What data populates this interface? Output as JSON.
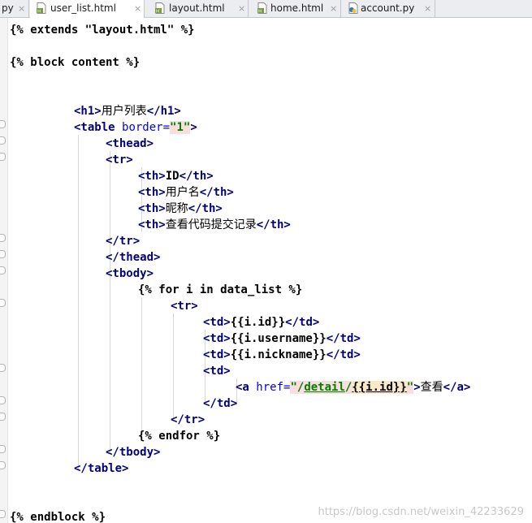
{
  "tabs": [
    {
      "label": "py",
      "active": false
    },
    {
      "label": "user_list.html",
      "active": true
    },
    {
      "label": "layout.html",
      "active": false
    },
    {
      "label": "home.html",
      "active": false
    },
    {
      "label": "account.py",
      "active": false
    }
  ],
  "close_glyph": "×",
  "code": {
    "l1": {
      "a": "{% extends \"layout.html\" %}"
    },
    "l2": {
      "a": "{% block content %}"
    },
    "l3": {
      "t1": "<h1>",
      "txt": "用户列表",
      "t2": "</h1>"
    },
    "l4": {
      "t1": "<table ",
      "attr": "border=",
      "val": "\"1\"",
      "t2": ">"
    },
    "l5": {
      "t": "<thead>"
    },
    "l6": {
      "t": "<tr>"
    },
    "l7": {
      "t1": "<th>",
      "txt": "ID",
      "t2": "</th>"
    },
    "l8": {
      "t1": "<th>",
      "txt": "用户名",
      "t2": "</th>"
    },
    "l9": {
      "t1": "<th>",
      "txt": "昵称",
      "t2": "</th>"
    },
    "l10": {
      "t1": "<th>",
      "txt": "查看代码提交记录",
      "t2": "</th>"
    },
    "l11": {
      "t": "</tr>"
    },
    "l12": {
      "t": "</thead>"
    },
    "l13": {
      "t": "<tbody>"
    },
    "l14": {
      "a": "{% for i in data_list %}"
    },
    "l15": {
      "t": "<tr>"
    },
    "l16": {
      "t1": "<td>",
      "txt": "{{i.id}}",
      "t2": "</td>"
    },
    "l17": {
      "t1": "<td>",
      "txt": "{{i.username}}",
      "t2": "</td>"
    },
    "l18": {
      "t1": "<td>",
      "txt": "{{i.nickname}}",
      "t2": "</td>"
    },
    "l19": {
      "t": "<td>"
    },
    "l20": {
      "t1": "<a ",
      "attr": "href=",
      "q1": "\"/",
      "url": "detail",
      "slash": "/",
      "tpl": "{{i.id}}",
      "q2": "\"",
      "t2": ">",
      "txt": "查看",
      "t3": "</a>"
    },
    "l21": {
      "t": "</td>"
    },
    "l22": {
      "t": "</tr>"
    },
    "l23": {
      "a": "{% endfor %}"
    },
    "l24": {
      "t": "</tbody>"
    },
    "l25": {
      "t": "</table>"
    },
    "l26": {
      "a": "{% endblock %}"
    }
  },
  "watermark": "https://blog.csdn.net/weixin_42233629"
}
